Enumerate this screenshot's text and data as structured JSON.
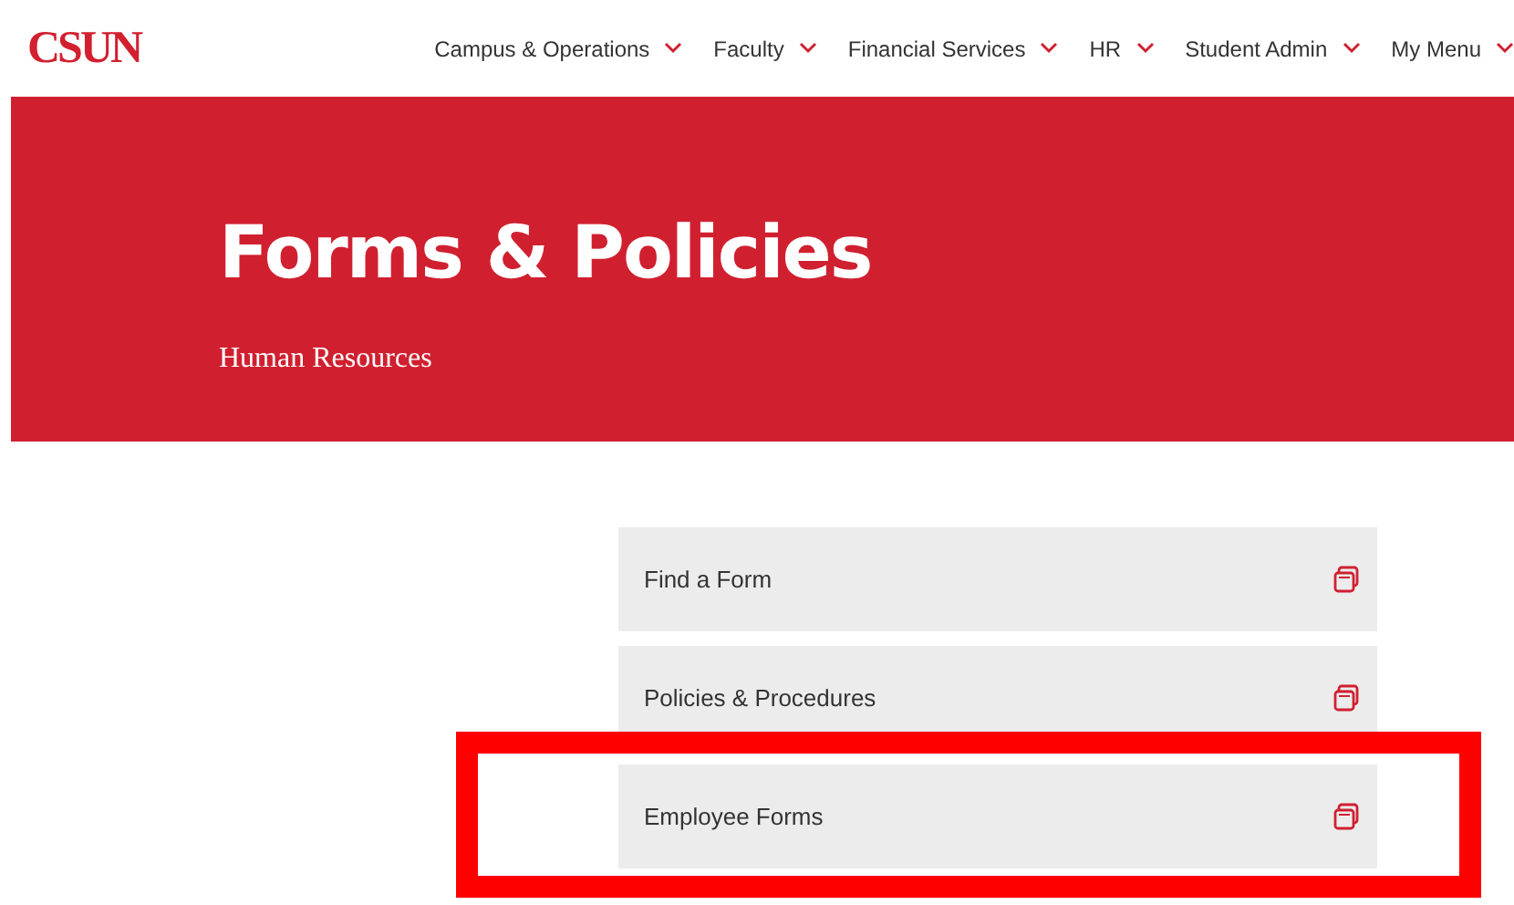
{
  "logo": "CSUN",
  "nav": [
    {
      "label": "Campus & Operations"
    },
    {
      "label": "Faculty"
    },
    {
      "label": "Financial Services"
    },
    {
      "label": "HR"
    },
    {
      "label": "Student Admin"
    },
    {
      "label": "My Menu"
    }
  ],
  "banner": {
    "title": "Forms & Policies",
    "subtitle": "Human Resources"
  },
  "links": [
    {
      "label": "Find a Form",
      "highlighted": false
    },
    {
      "label": "Policies & Procedures",
      "highlighted": false
    },
    {
      "label": "Employee Forms",
      "highlighted": true
    }
  ]
}
